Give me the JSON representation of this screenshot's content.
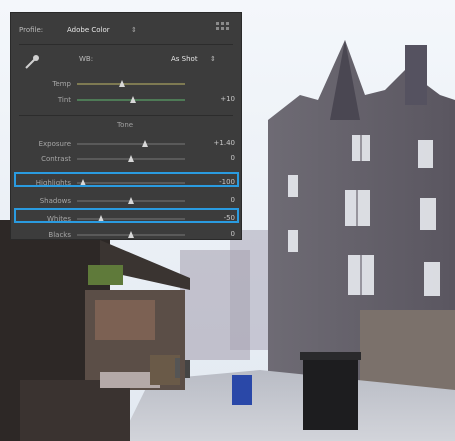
{
  "panel": {
    "profile_label": "Profile:",
    "profile_value": "Adobe Color",
    "wb_label": "WB:",
    "wb_value": "As Shot",
    "sliders": [
      {
        "label": "Temp",
        "value": "",
        "pos": 0.42,
        "track_color": "#7e7a52"
      },
      {
        "label": "Tint",
        "value": "+10",
        "pos": 0.52,
        "track_color": "#4e7a56"
      },
      {
        "label": "Exposure",
        "value": "+1.40",
        "pos": 0.63,
        "track_color": "#5a5a5a"
      },
      {
        "label": "Contrast",
        "value": "0",
        "pos": 0.5,
        "track_color": "#5a5a5a"
      },
      {
        "label": "Highlights",
        "value": "-100",
        "pos": 0.06,
        "track_color": "#5a5a5a"
      },
      {
        "label": "Shadows",
        "value": "0",
        "pos": 0.5,
        "track_color": "#5a5a5a"
      },
      {
        "label": "Whites",
        "value": "-50",
        "pos": 0.22,
        "track_color": "#5a5a5a"
      },
      {
        "label": "Blacks",
        "value": "0",
        "pos": 0.5,
        "track_color": "#5a5a5a"
      }
    ],
    "tone_header": "Tone"
  },
  "colors": {
    "panel_bg": "#3c3c3c",
    "highlight_border": "#2a9be0"
  }
}
